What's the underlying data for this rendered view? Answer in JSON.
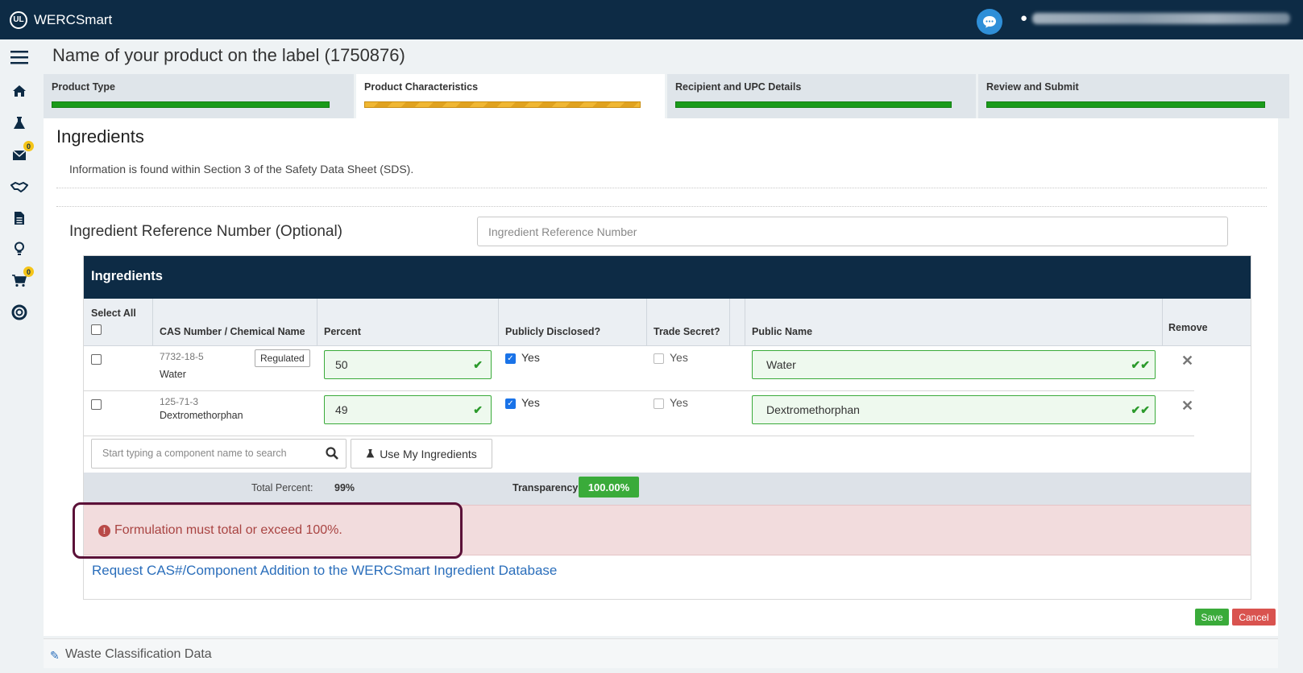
{
  "app": {
    "brand": "WERCSmart",
    "logo_text": "UL"
  },
  "page": {
    "title": "Name of your product on the label (1750876)"
  },
  "steps": [
    {
      "label": "Product Type",
      "status": "complete"
    },
    {
      "label": "Product Characteristics",
      "status": "in-progress"
    },
    {
      "label": "Recipient and UPC Details",
      "status": "complete"
    },
    {
      "label": "Review and Submit",
      "status": "complete"
    }
  ],
  "nav": {
    "badges": {
      "messages": "0",
      "cart": "0"
    },
    "icons": [
      "menu-icon",
      "home-icon",
      "flask-icon",
      "envelope-icon",
      "handshake-icon",
      "document-icon",
      "lightbulb-icon",
      "cart-icon",
      "lifebuoy-icon"
    ]
  },
  "section": {
    "title": "Ingredients",
    "info": "Information is found within Section 3 of the Safety Data Sheet (SDS)."
  },
  "reference": {
    "label": "Ingredient Reference Number (Optional)",
    "placeholder": "Ingredient Reference Number"
  },
  "table": {
    "header": "Ingredients",
    "columns": {
      "select_all": "Select All",
      "cas": "CAS Number / Chemical Name",
      "percent": "Percent",
      "publicly": "Publicly Disclosed?",
      "trade": "Trade Secret?",
      "public_name": "Public Name",
      "remove": "Remove"
    },
    "rows": [
      {
        "cas": "7732-18-5",
        "name": "Water",
        "tag": "Regulated",
        "percent": "50",
        "publicly_disclosed": true,
        "publicly_label": "Yes",
        "trade_secret": false,
        "trade_label": "Yes",
        "public_name": "Water"
      },
      {
        "cas": "125-71-3",
        "name": "Dextromethorphan",
        "percent": "49",
        "publicly_disclosed": true,
        "publicly_label": "Yes",
        "trade_secret": false,
        "trade_label": "Yes",
        "public_name": "Dextromethorphan"
      }
    ],
    "search_placeholder": "Start typing a component name to search",
    "use_my_ingredients": "Use My Ingredients",
    "total_label": "Total Percent:",
    "total_value": "99%",
    "transparency_label": "Transparency:",
    "transparency_value": "100.00%"
  },
  "alert": {
    "message": "Formulation must total or exceed 100%."
  },
  "request_link": "Request CAS#/Component Addition to the WERCSmart Ingredient Database",
  "actions": {
    "save": "Save",
    "cancel": "Cancel"
  },
  "waste": {
    "label": "Waste Classification Data"
  },
  "colors": {
    "navy": "#0d2b45",
    "success": "#3aab3a",
    "danger": "#d9534f",
    "alert_bg": "#f2dcdd",
    "link": "#2a6ebb",
    "highlight_outline": "#5b1138"
  }
}
